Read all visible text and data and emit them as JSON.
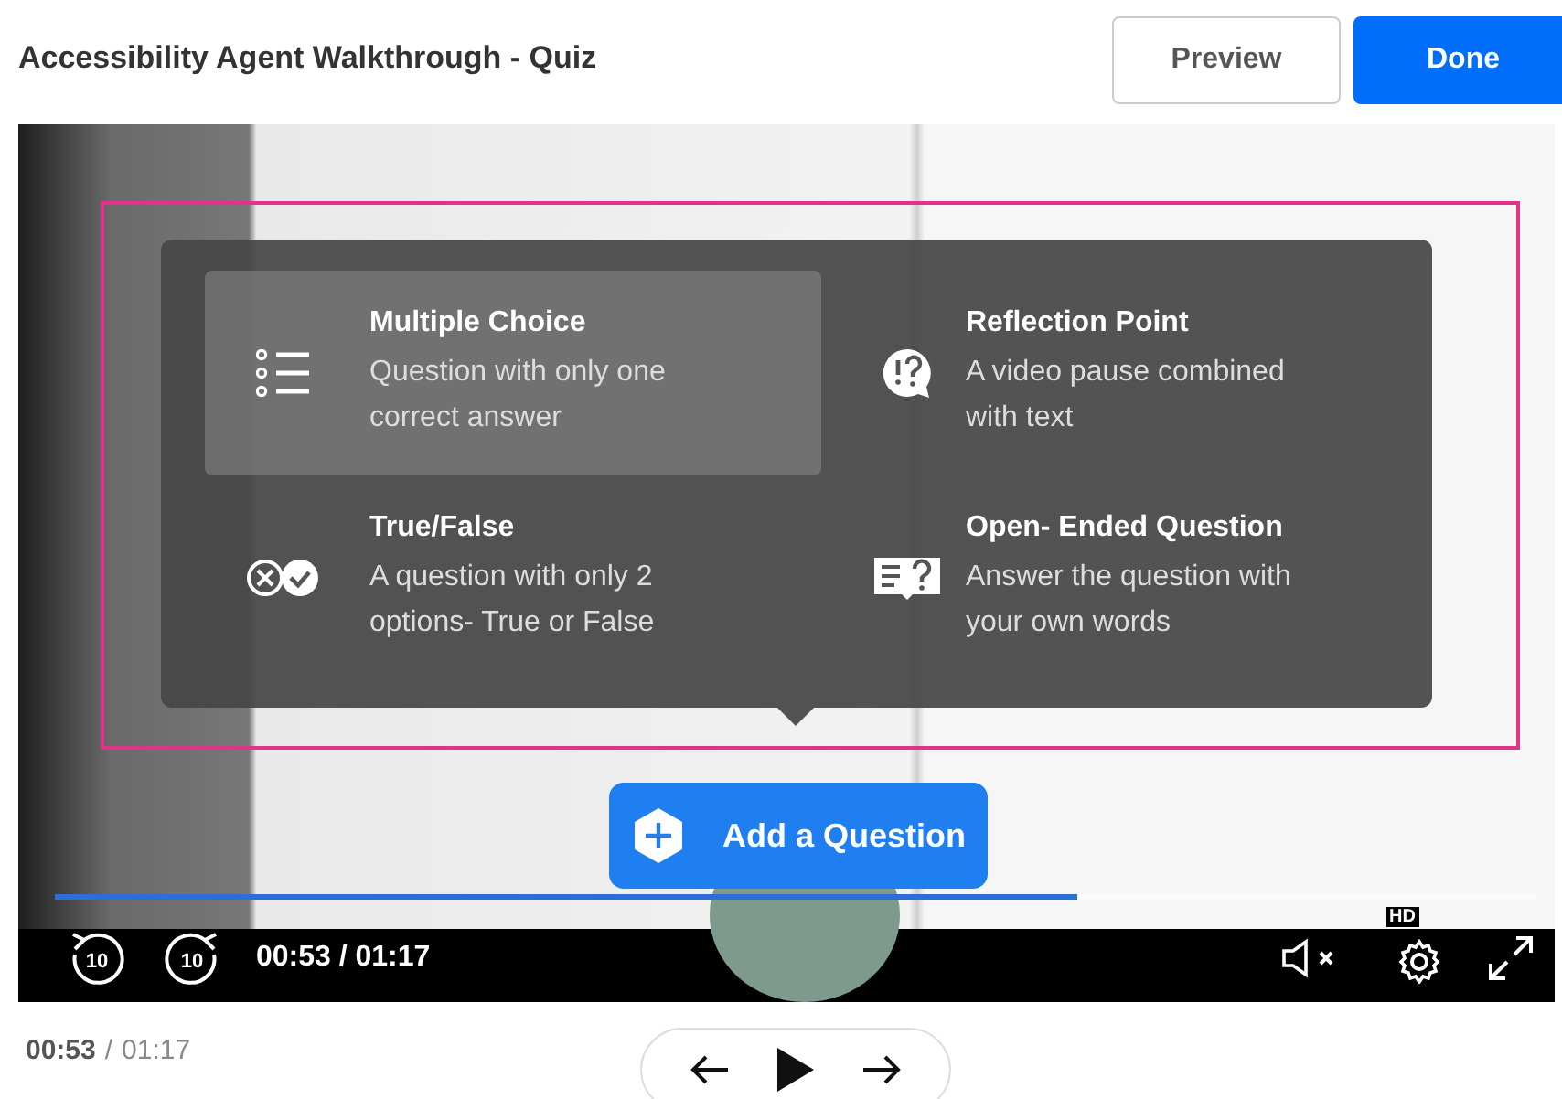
{
  "header": {
    "title": "Accessibility Agent Walkthrough - Quiz",
    "buttons": [
      {
        "label": "Preview",
        "kind": "secondary"
      },
      {
        "label": "Done",
        "kind": "primary"
      }
    ]
  },
  "question_menu": {
    "items": [
      {
        "title": "Multiple Choice",
        "description": "Question with only one correct answer",
        "kind": "multiple",
        "selected": true
      },
      {
        "title": "Reflection Point",
        "description": "A video pause combined with text",
        "kind": "reflection",
        "selected": false
      },
      {
        "title": "True/False",
        "description": "A question with only 2 options- True or False",
        "kind": "truefalse",
        "selected": false
      },
      {
        "title": "Open- Ended Question",
        "description": "Answer the question with your own words",
        "kind": "open",
        "selected": false
      }
    ]
  },
  "add_question_button": {
    "label": "Add a Question"
  },
  "player": {
    "progress": {
      "level": 0.69
    },
    "rewind_label": "10",
    "forward_label": "10",
    "time": "00:53 / 01:17",
    "quality_badge": "HD"
  },
  "footer": {
    "current_time": "00:53",
    "separator": "/",
    "total_time": "01:17"
  }
}
